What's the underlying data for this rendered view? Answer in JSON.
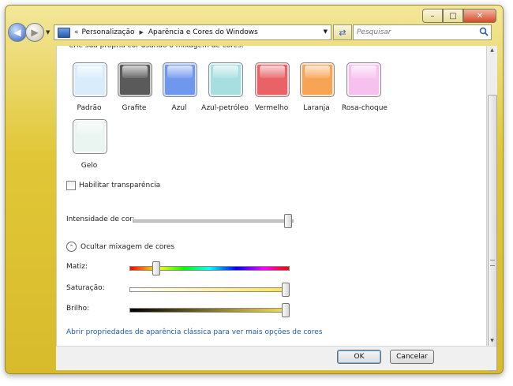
{
  "window": {
    "minimize_icon": "minimize-icon",
    "maximize_icon": "maximize-icon",
    "close_icon": "close-icon"
  },
  "nav": {
    "breadcrumb": [
      "Personalização",
      "Aparência e Cores do Windows"
    ],
    "breadcrumb_prefix": "«",
    "search_placeholder": "Pesquisar"
  },
  "content": {
    "clipped_text": "Crie sua própria cor usando o mixagem de cores:",
    "swatches": [
      {
        "label": "Padrão",
        "color": "#d8ecfb"
      },
      {
        "label": "Grafite",
        "color": "#5a5a5a"
      },
      {
        "label": "Azul",
        "color": "#6f97ee"
      },
      {
        "label": "Azul-petróleo",
        "color": "#a7dfe0"
      },
      {
        "label": "Vermelho",
        "color": "#e86266"
      },
      {
        "label": "Laranja",
        "color": "#f8a455"
      },
      {
        "label": "Rosa-choque",
        "color": "#f7c1ef"
      },
      {
        "label": "Gelo",
        "color": "#eaf4f1"
      }
    ],
    "transparency_label": "Habilitar transparência",
    "transparency_checked": false,
    "intensity_label": "Intensidade de cor:",
    "intensity_value": 1.0,
    "mixer_toggle_label": "Ocultar mixagem de cores",
    "hue_label": "Matiz:",
    "hue_value": 0.15,
    "saturation_label": "Saturação:",
    "saturation_value": 1.0,
    "brightness_label": "Brilho:",
    "brightness_value": 1.0,
    "classic_link": "Abrir propriedades de aparência clássica para ver mais opções de cores"
  },
  "buttons": {
    "ok": "OK",
    "cancel": "Cancelar"
  },
  "colors": {
    "accent_link": "#1f5ba6",
    "frame": "#e1c737"
  }
}
